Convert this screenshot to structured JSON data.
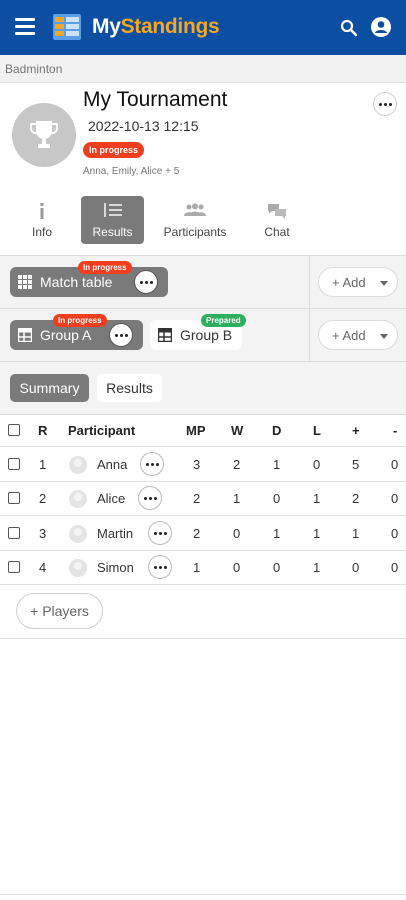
{
  "app": {
    "brand_part1": "My",
    "brand_part2": "Standings"
  },
  "breadcrumb": "Badminton",
  "tournament": {
    "title": "My Tournament",
    "datetime": "2022-10-13 12:15",
    "status": "In progress",
    "players": "Anna, Emily, Alice + 5"
  },
  "tabs": [
    {
      "label": "Info",
      "icon": "info-icon"
    },
    {
      "label": "Results",
      "icon": "list-icon",
      "active": true
    },
    {
      "label": "Participants",
      "icon": "people-icon"
    },
    {
      "label": "Chat",
      "icon": "chat-icon"
    }
  ],
  "stages": {
    "match_table": {
      "label": "Match table",
      "badge": "In progress"
    },
    "group_a": {
      "label": "Group A",
      "badge": "In progress"
    },
    "group_b": {
      "label": "Group B",
      "badge": "Prepared"
    },
    "add_label": "+ Add"
  },
  "subtabs": {
    "summary": "Summary",
    "results": "Results"
  },
  "table": {
    "headers": {
      "rank": "R",
      "participant": "Participant",
      "mp": "MP",
      "w": "W",
      "d": "D",
      "l": "L",
      "plus": "+",
      "minus": "-"
    },
    "rows": [
      {
        "rank": "1",
        "name": "Anna",
        "mp": "3",
        "w": "2",
        "d": "1",
        "l": "0",
        "plus": "5",
        "minus": "0"
      },
      {
        "rank": "2",
        "name": "Alice",
        "mp": "2",
        "w": "1",
        "d": "0",
        "l": "1",
        "plus": "2",
        "minus": "0"
      },
      {
        "rank": "3",
        "name": "Martin",
        "mp": "2",
        "w": "0",
        "d": "1",
        "l": "1",
        "plus": "1",
        "minus": "0"
      },
      {
        "rank": "4",
        "name": "Simon",
        "mp": "1",
        "w": "0",
        "d": "0",
        "l": "1",
        "plus": "0",
        "minus": "0"
      }
    ]
  },
  "add_players": "+ Players",
  "colors": {
    "header": "#0b4ea2",
    "brand_accent": "#f5a623",
    "in_progress": "#f03e1e",
    "prepared": "#2fae5d",
    "active_tab": "#7a7a7a"
  }
}
